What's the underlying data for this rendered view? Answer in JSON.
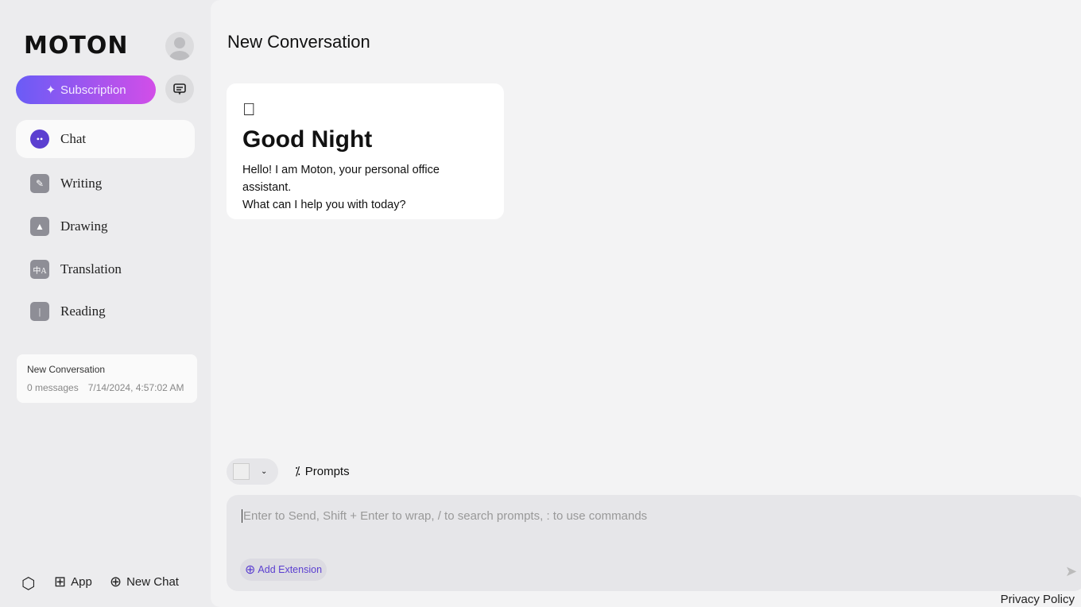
{
  "sidebar": {
    "logo": "MOTON",
    "subscription_label": "Subscription",
    "nav": [
      {
        "label": "Chat",
        "icon": "chat-bubble-icon"
      },
      {
        "label": "Writing",
        "icon": "pencil-icon"
      },
      {
        "label": "Drawing",
        "icon": "image-icon"
      },
      {
        "label": "Translation",
        "icon": "translate-icon"
      },
      {
        "label": "Reading",
        "icon": "book-icon"
      }
    ],
    "conversation": {
      "title": "New Conversation",
      "messages": "0 messages",
      "timestamp": "7/14/2024, 4:57:02 AM"
    },
    "footer": {
      "app_label": "App",
      "new_chat_label": "New Chat"
    }
  },
  "main": {
    "title": "New Conversation",
    "greeting": {
      "icon": "",
      "heading": "Good Night",
      "text_line1": "Hello! I am Moton, your personal office assistant.",
      "text_line2": "What can I help you with today?"
    },
    "prompts_label": "Prompts",
    "input_placeholder": "Enter to Send, Shift + Enter to wrap, / to search prompts, : to use commands",
    "add_extension_label": "Add Extension",
    "privacy_label": "Privacy Policy"
  },
  "colors": {
    "accent": "#6a5cf6",
    "accent_end": "#d24ee8",
    "chat_icon": "#5b3fd0"
  }
}
